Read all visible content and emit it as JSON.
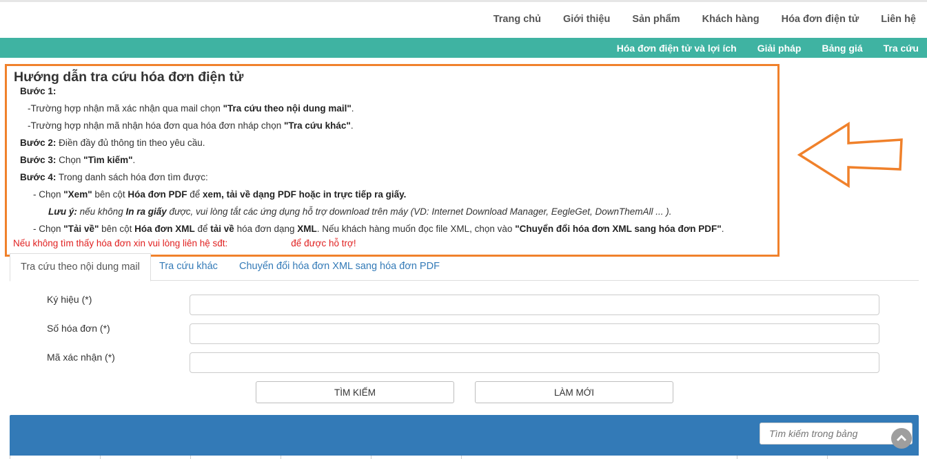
{
  "nav": {
    "items": [
      "Trang chủ",
      "Giới thiệu",
      "Sản phẩm",
      "Khách hàng",
      "Hóa đơn điện tử",
      "Liên hệ"
    ]
  },
  "subnav": {
    "items": [
      "Hóa đơn điện tử và lợi ích",
      "Giải pháp",
      "Bảng giá",
      "Tra cứu"
    ]
  },
  "guide": {
    "title": "Hướng dẫn tra cứu hóa đơn điện tử",
    "step1": "Bước 1:",
    "step1_a_pre": "-Trường hợp nhận mã xác nhận qua mail chọn ",
    "step1_a_bold": "\"Tra cứu theo nội dung mail\"",
    "step1_a_post": ".",
    "step1_b_pre": "-Trường hợp nhận mã nhận hóa đơn qua hóa đơn nháp chọn ",
    "step1_b_bold": "\"Tra cứu khác\"",
    "step1_b_post": ".",
    "step2_label": "Bước 2:",
    "step2_text": " Điền đầy đủ thông tin theo yêu cầu.",
    "step3_label": "Bước 3:",
    "step3_pre": " Chọn ",
    "step3_bold": "\"Tìm kiếm\"",
    "step3_post": ".",
    "step4_label": "Bước 4:",
    "step4_text": " Trong danh sách hóa đơn tìm được:",
    "s4a_pre": "- Chọn ",
    "s4a_b1": "\"Xem\"",
    "s4a_mid": " bên cột ",
    "s4a_b2": "Hóa đơn PDF",
    "s4a_mid2": " để ",
    "s4a_b3": "xem, tải về dạng PDF hoặc in trực tiếp ra giấy.",
    "note_label": "Lưu ý:",
    "note_mid": " nếu không ",
    "note_bold": "In ra giấy",
    "note_text": " được, vui lòng tắt các ứng dụng hỗ trợ download trên máy (VD: Internet Download Manager, EegleGet, DownThemAll ... ).",
    "s4b_pre": "- Chọn ",
    "s4b_b1": "\"Tải về\"",
    "s4b_mid": " bên cột ",
    "s4b_b2": "Hóa đơn XML",
    "s4b_mid2": " để ",
    "s4b_b3": "tải về",
    "s4b_mid3": " hóa đơn dạng ",
    "s4b_b4": "XML",
    "s4b_mid4": ". Nếu khách hàng muốn đọc file XML, chọn vào ",
    "s4b_b5": "\"Chuyển đổi hóa đơn XML sang hóa đơn PDF\"",
    "s4b_post": ".",
    "contact_a": "Nếu không tìm thấy hóa đơn xin vui lòng liên hệ sđt:",
    "contact_b": "để được hỗ trợ!"
  },
  "tabs": [
    "Tra cứu theo nội dung mail",
    "Tra cứu khác",
    "Chuyển đổi hóa đơn XML sang hóa đơn PDF"
  ],
  "form": {
    "symbol_label": "Ký hiệu (*)",
    "number_label": "Số hóa đơn (*)",
    "code_label": "Mã xác nhận (*)",
    "search_button": "TÌM KIẾM",
    "reset_button": "LÀM MỚI"
  },
  "table": {
    "search_placeholder": "Tìm kiếm trong bảng"
  },
  "colors": {
    "teal": "#3fb3a2",
    "highlight_orange": "#f0812b",
    "table_header_blue": "#337ab7"
  }
}
